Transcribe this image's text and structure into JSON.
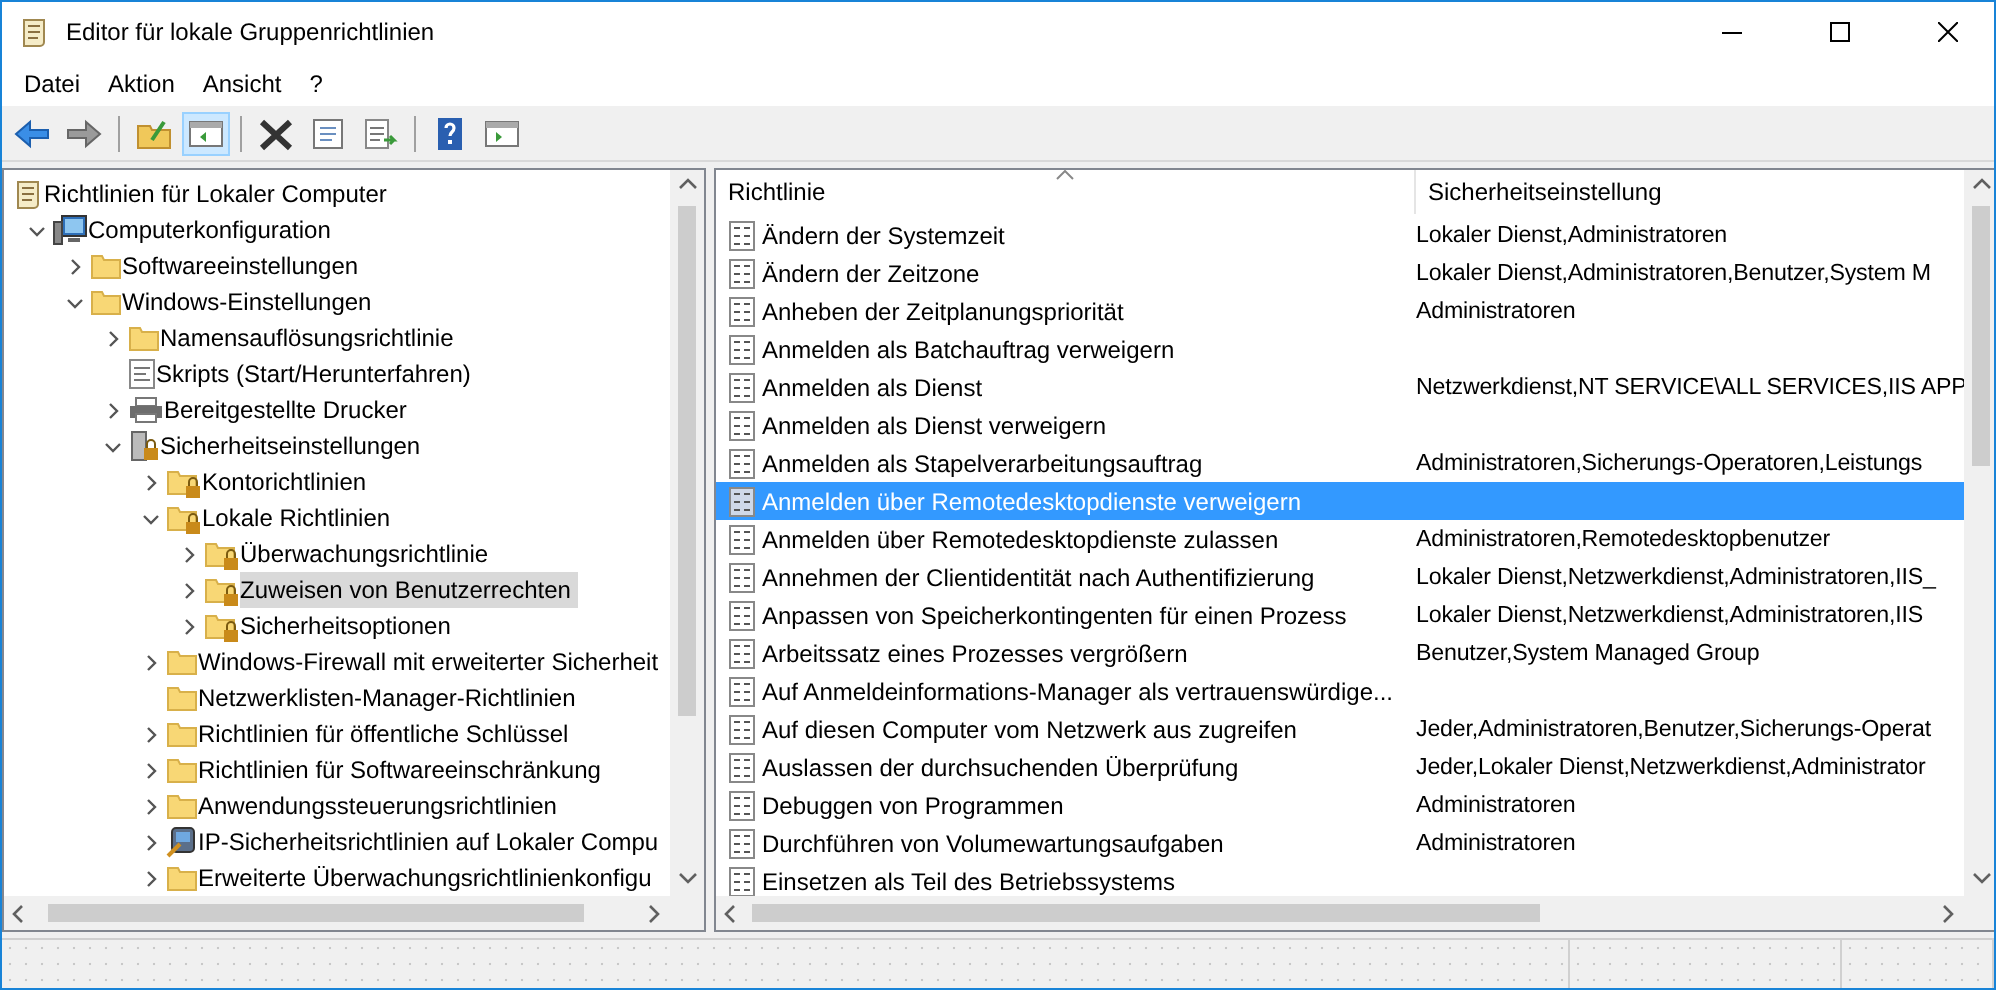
{
  "window": {
    "title": "Editor für lokale Gruppenrichtlinien"
  },
  "menu": [
    "Datei",
    "Aktion",
    "Ansicht",
    "?"
  ],
  "toolbar": [
    {
      "kind": "back",
      "pressed": false
    },
    {
      "kind": "forward",
      "pressed": false
    },
    {
      "kind": "sep"
    },
    {
      "kind": "up",
      "pressed": false
    },
    {
      "kind": "tree",
      "pressed": true
    },
    {
      "kind": "sep"
    },
    {
      "kind": "delete",
      "pressed": false
    },
    {
      "kind": "properties",
      "pressed": false
    },
    {
      "kind": "export",
      "pressed": false
    },
    {
      "kind": "sep"
    },
    {
      "kind": "help",
      "pressed": false
    },
    {
      "kind": "actionpane",
      "pressed": false
    }
  ],
  "tree": [
    {
      "label": "Richtlinien für Lokaler Computer",
      "kind": "policy",
      "selected": false,
      "children": [
        {
          "label": "Computerkonfiguration",
          "kind": "computer",
          "expanded": true,
          "selected": false,
          "children": [
            {
              "label": "Softwareeinstellungen",
              "kind": "folder",
              "expanded": false,
              "selected": false
            },
            {
              "label": "Windows-Einstellungen",
              "kind": "folder",
              "expanded": true,
              "selected": false,
              "children": [
                {
                  "label": "Namensauflösungsrichtlinie",
                  "kind": "folder",
                  "expanded": false,
                  "selected": false
                },
                {
                  "label": "Skripts (Start/Herunterfahren)",
                  "kind": "script",
                  "selected": false
                },
                {
                  "label": "Bereitgestellte Drucker",
                  "kind": "printer",
                  "expanded": false,
                  "selected": false
                },
                {
                  "label": "Sicherheitseinstellungen",
                  "kind": "security",
                  "expanded": true,
                  "selected": false,
                  "children": [
                    {
                      "label": "Kontorichtlinien",
                      "kind": "secure-folder",
                      "expanded": false,
                      "selected": false
                    },
                    {
                      "label": "Lokale Richtlinien",
                      "kind": "secure-folder",
                      "expanded": true,
                      "selected": false,
                      "children": [
                        {
                          "label": "Überwachungsrichtlinie",
                          "kind": "secure-folder",
                          "expanded": false,
                          "selected": false
                        },
                        {
                          "label": "Zuweisen von Benutzerrechten",
                          "kind": "secure-folder",
                          "expanded": false,
                          "selected": true
                        },
                        {
                          "label": "Sicherheitsoptionen",
                          "kind": "secure-folder",
                          "expanded": false,
                          "selected": false
                        }
                      ]
                    },
                    {
                      "label": "Windows-Firewall mit erweiterter Sicherheit",
                      "kind": "folder",
                      "expanded": false,
                      "selected": false
                    },
                    {
                      "label": "Netzwerklisten-Manager-Richtlinien",
                      "kind": "folder",
                      "selected": false
                    },
                    {
                      "label": "Richtlinien für öffentliche Schlüssel",
                      "kind": "folder",
                      "expanded": false,
                      "selected": false
                    },
                    {
                      "label": "Richtlinien für Softwareeinschränkung",
                      "kind": "folder",
                      "expanded": false,
                      "selected": false
                    },
                    {
                      "label": "Anwendungssteuerungsrichtlinien",
                      "kind": "folder",
                      "expanded": false,
                      "selected": false
                    },
                    {
                      "label": "IP-Sicherheitsrichtlinien auf Lokaler Compu",
                      "kind": "ipsec",
                      "expanded": false,
                      "selected": false
                    },
                    {
                      "label": "Erweiterte Überwachungsrichtlinienkonfigu",
                      "kind": "folder",
                      "expanded": false,
                      "selected": false
                    }
                  ]
                }
              ]
            }
          ]
        }
      ]
    }
  ],
  "table": {
    "columns": [
      "Richtlinie",
      "Sicherheitseinstellung"
    ],
    "rows": [
      {
        "policy": "Ändern der Systemzeit",
        "setting": "Lokaler Dienst,Administratoren",
        "selected": false
      },
      {
        "policy": "Ändern der Zeitzone",
        "setting": "Lokaler Dienst,Administratoren,Benutzer,System M",
        "selected": false
      },
      {
        "policy": "Anheben der Zeitplanungspriorität",
        "setting": "Administratoren",
        "selected": false
      },
      {
        "policy": "Anmelden als Batchauftrag verweigern",
        "selected": false
      },
      {
        "policy": "Anmelden als Dienst",
        "setting": "Netzwerkdienst,NT SERVICE\\ALL SERVICES,IIS APP",
        "selected": false
      },
      {
        "policy": "Anmelden als Dienst verweigern",
        "selected": false
      },
      {
        "policy": "Anmelden als Stapelverarbeitungsauftrag",
        "setting": "Administratoren,Sicherungs-Operatoren,Leistungs",
        "selected": false
      },
      {
        "policy": "Anmelden über Remotedesktopdienste verweigern",
        "selected": true
      },
      {
        "policy": "Anmelden über Remotedesktopdienste zulassen",
        "setting": "Administratoren,Remotedesktopbenutzer",
        "selected": false
      },
      {
        "policy": "Annehmen der Clientidentität nach Authentifizierung",
        "setting": "Lokaler Dienst,Netzwerkdienst,Administratoren,IIS_",
        "selected": false
      },
      {
        "policy": "Anpassen von Speicherkontingenten für einen Prozess",
        "setting": "Lokaler Dienst,Netzwerkdienst,Administratoren,IIS",
        "selected": false
      },
      {
        "policy": "Arbeitssatz eines Prozesses vergrößern",
        "setting": "Benutzer,System Managed Group",
        "selected": false
      },
      {
        "policy": "Auf Anmeldeinformations-Manager als vertrauenswürdige...",
        "selected": false
      },
      {
        "policy": "Auf diesen Computer vom Netzwerk aus zugreifen",
        "setting": "Jeder,Administratoren,Benutzer,Sicherungs-Operat",
        "selected": false
      },
      {
        "policy": "Auslassen der durchsuchenden Überprüfung",
        "setting": "Jeder,Lokaler Dienst,Netzwerkdienst,Administrator",
        "selected": false
      },
      {
        "policy": "Debuggen von Programmen",
        "setting": "Administratoren",
        "selected": false
      },
      {
        "policy": "Durchführen von Volumewartungsaufgaben",
        "setting": "Administratoren",
        "selected": false
      },
      {
        "policy": "Einsetzen als Teil des Betriebssystems",
        "selected": false
      }
    ]
  }
}
